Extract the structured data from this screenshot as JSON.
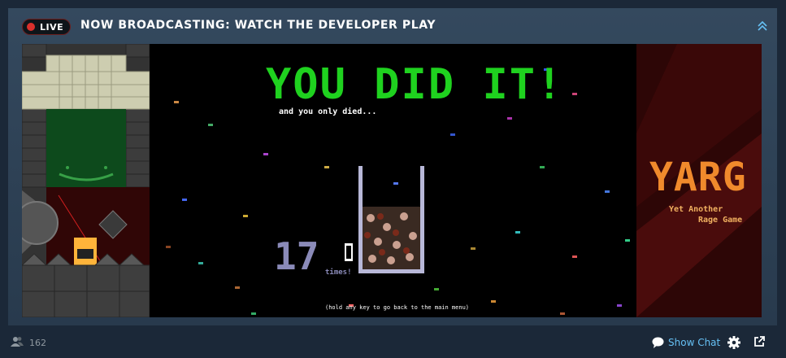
{
  "header": {
    "live_label": "LIVE",
    "title": "NOW BROADCASTING: WATCH THE DEVELOPER PLAY",
    "collapse_icon": "chevron-up-double-icon"
  },
  "game": {
    "headline": "YOU DID IT!",
    "subline": "and you only died...",
    "death_count": "17",
    "times_label": "times!",
    "hint": "(hold any key to go back to the main menu)",
    "logo_title": "YARG",
    "logo_subtitle_1": "Yet Another",
    "logo_subtitle_2": "Rage Game",
    "colors": {
      "headline": "#1fd21f",
      "logo": "#f08a2c",
      "death_count": "#8a8ab8"
    }
  },
  "footer": {
    "viewer_icon": "viewers-icon",
    "viewer_count": "162",
    "show_chat_label": "Show Chat",
    "chat_icon": "chat-bubble-icon",
    "settings_icon": "gear-icon",
    "popout_icon": "popout-icon"
  }
}
